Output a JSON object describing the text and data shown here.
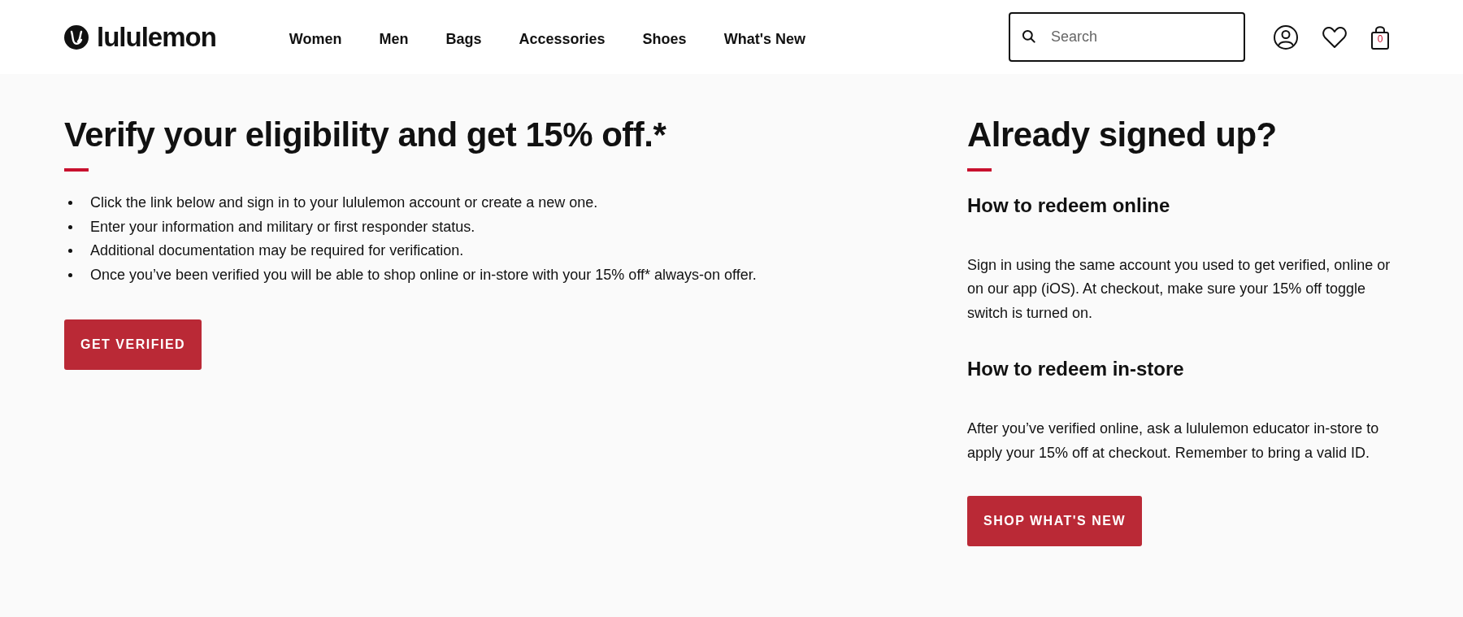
{
  "header": {
    "logo": "lululemon",
    "nav": [
      "Women",
      "Men",
      "Bags",
      "Accessories",
      "Shoes",
      "What's New"
    ],
    "search": {
      "placeholder": "Search"
    },
    "bag_count": "0"
  },
  "main": {
    "title": "Verify your eligibility and get 15% off.*",
    "bullets": [
      "Click the link below and sign in to your lululemon account or create a new one.",
      "Enter your information and military or first responder status.",
      "Additional documentation may be required for verification.",
      "Once you’ve been verified you will be able to shop online or in-store with your 15% off* always-on offer."
    ],
    "button": "GET VERIFIED"
  },
  "aside": {
    "title": "Already signed up?",
    "sections": [
      {
        "heading": "How to redeem online",
        "text": "Sign in using the same account you used to get verified, online or on our app (iOS). At checkout, make sure your 15% off toggle switch is turned on."
      },
      {
        "heading": "How to redeem in-store",
        "text": "After you’ve verified online, ask a lululemon educator in-store to apply your 15% off at checkout. Remember to bring a valid ID."
      }
    ],
    "button": "SHOP WHAT'S NEW"
  }
}
